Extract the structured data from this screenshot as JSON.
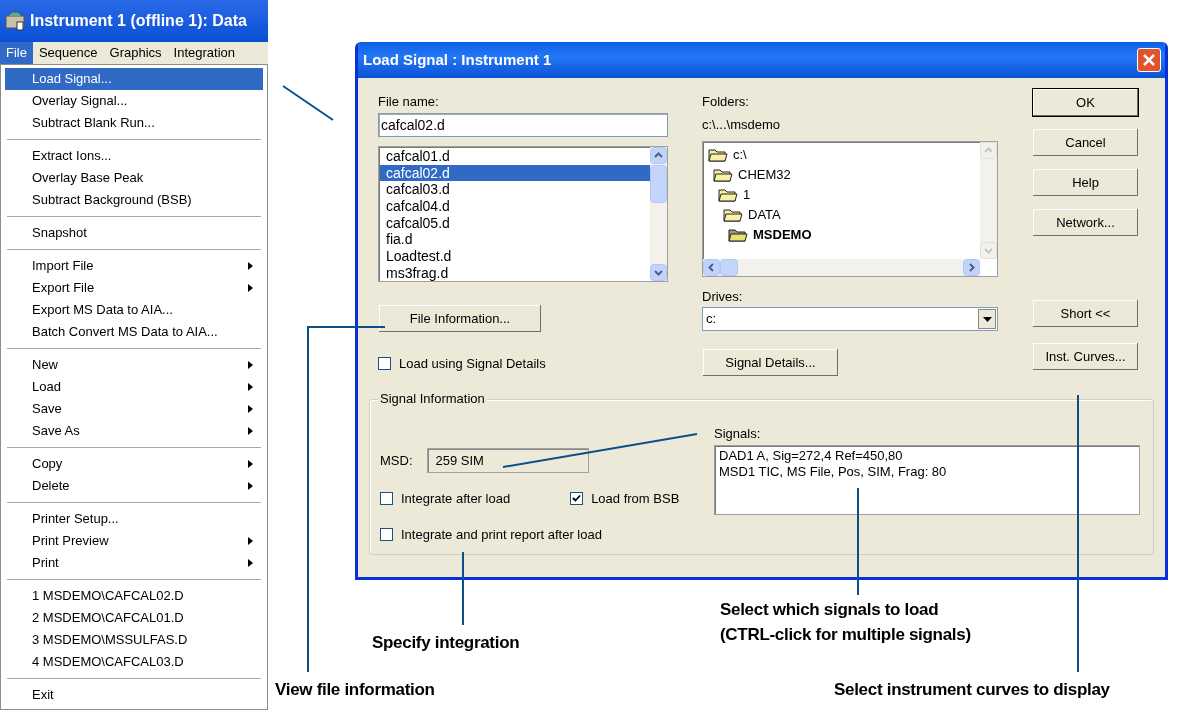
{
  "app_window": {
    "title": "Instrument 1 (offline 1): Data"
  },
  "menu_bar": [
    {
      "label": "File",
      "selected": true
    },
    {
      "label": "Sequence",
      "selected": false
    },
    {
      "label": "Graphics",
      "selected": false
    },
    {
      "label": "Integration",
      "selected": false
    }
  ],
  "file_menu": [
    [
      {
        "label": "Load Signal...",
        "selected": true,
        "submenu": false
      },
      {
        "label": "Overlay Signal...",
        "selected": false,
        "submenu": false
      },
      {
        "label": "Subtract Blank Run...",
        "selected": false,
        "submenu": false
      }
    ],
    [
      {
        "label": "Extract Ions...",
        "selected": false,
        "submenu": false
      },
      {
        "label": "Overlay Base Peak",
        "selected": false,
        "submenu": false
      },
      {
        "label": "Subtract Background (BSB)",
        "selected": false,
        "submenu": false
      }
    ],
    [
      {
        "label": "Snapshot",
        "selected": false,
        "submenu": false
      }
    ],
    [
      {
        "label": "Import File",
        "selected": false,
        "submenu": true
      },
      {
        "label": "Export File",
        "selected": false,
        "submenu": true
      },
      {
        "label": "Export MS Data to AIA...",
        "selected": false,
        "submenu": false
      },
      {
        "label": "Batch Convert MS Data to AIA...",
        "selected": false,
        "submenu": false
      }
    ],
    [
      {
        "label": "New",
        "selected": false,
        "submenu": true
      },
      {
        "label": "Load",
        "selected": false,
        "submenu": true
      },
      {
        "label": "Save",
        "selected": false,
        "submenu": true
      },
      {
        "label": "Save As",
        "selected": false,
        "submenu": true
      }
    ],
    [
      {
        "label": "Copy",
        "selected": false,
        "submenu": true
      },
      {
        "label": "Delete",
        "selected": false,
        "submenu": true
      }
    ],
    [
      {
        "label": "Printer Setup...",
        "selected": false,
        "submenu": false
      },
      {
        "label": "Print Preview",
        "selected": false,
        "submenu": true
      },
      {
        "label": "Print",
        "selected": false,
        "submenu": true
      }
    ],
    [
      {
        "label": "1 MSDEMO\\CAFCAL02.D",
        "selected": false,
        "submenu": false
      },
      {
        "label": "2 MSDEMO\\CAFCAL01.D",
        "selected": false,
        "submenu": false
      },
      {
        "label": "3 MSDEMO\\MSSULFAS.D",
        "selected": false,
        "submenu": false
      },
      {
        "label": "4 MSDEMO\\CAFCAL03.D",
        "selected": false,
        "submenu": false
      }
    ],
    [
      {
        "label": "Exit",
        "selected": false,
        "submenu": false
      }
    ]
  ],
  "dialog": {
    "title": "Load Signal : Instrument 1",
    "file_name": {
      "label": "File name:",
      "value": "cafcal02.d"
    },
    "files": [
      {
        "label": "cafcal01.d",
        "selected": false
      },
      {
        "label": "cafcal02.d",
        "selected": true
      },
      {
        "label": "cafcal03.d",
        "selected": false
      },
      {
        "label": "cafcal04.d",
        "selected": false
      },
      {
        "label": "cafcal05.d",
        "selected": false
      },
      {
        "label": "fia.d",
        "selected": false
      },
      {
        "label": "Loadtest.d",
        "selected": false
      },
      {
        "label": "ms3frag.d",
        "selected": false
      }
    ],
    "file_information_button": "File Information...",
    "load_using_signal_details": {
      "label": "Load using Signal Details",
      "checked": false
    },
    "folders_label": "Folders:",
    "folder_path": "c:\\...\\msdemo",
    "folders": [
      {
        "label": "c:\\",
        "selected": false,
        "children": [
          {
            "label": "CHEM32",
            "selected": false,
            "children": [
              {
                "label": "1",
                "selected": false,
                "children": [
                  {
                    "label": "DATA",
                    "selected": false,
                    "children": [
                      {
                        "label": "MSDEMO",
                        "selected": true
                      }
                    ]
                  }
                ]
              }
            ]
          }
        ]
      }
    ],
    "drives": {
      "label": "Drives:",
      "value": "c:"
    },
    "signal_details_button": "Signal Details...",
    "buttons": [
      {
        "label": "OK",
        "default": true
      },
      {
        "label": "Cancel",
        "default": false
      },
      {
        "label": "Help",
        "default": false
      },
      {
        "label": "Network...",
        "default": false
      }
    ],
    "short_button": "Short <<",
    "inst_curves_button": "Inst. Curves...",
    "signal_information": {
      "title": "Signal Information",
      "msd_label": "MSD:",
      "msd_value": "259 SIM",
      "integrate_after_load": {
        "label": "Integrate after load",
        "checked": false
      },
      "load_from_bsb": {
        "label": "Load from BSB",
        "checked": true
      },
      "integrate_and_print": {
        "label": "Integrate and print report after load",
        "checked": false
      },
      "signals_label": "Signals:",
      "signals": [
        "DAD1 A, Sig=272,4 Ref=450,80",
        "MSD1 TIC, MS File, Pos, SIM, Frag: 80"
      ]
    }
  },
  "callouts": [
    {
      "text": "Specify integration"
    },
    {
      "text": "Select which signals to load\n(CTRL-click for multiple signals)"
    },
    {
      "text": "View file information"
    },
    {
      "text": "Select instrument curves to display"
    }
  ]
}
